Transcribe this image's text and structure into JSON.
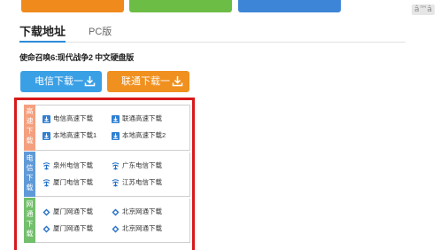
{
  "corner_label": "â™â",
  "tabs": [
    {
      "label": "下载地址"
    },
    {
      "label": "PC版"
    }
  ],
  "game_title": "使命召唤6:现代战争2 中文硬盘版",
  "buttons": {
    "telecom": "电信下载一",
    "unicom": "联通下载一"
  },
  "groups": [
    {
      "label": "高速下载",
      "items": [
        "电信高速下载",
        "联通高速下载",
        "本地高速下载1",
        "本地高速下载2"
      ],
      "icon": "download-icon"
    },
    {
      "label": "电信下载",
      "items": [
        "泉州电信下载",
        "广东电信下载",
        "厦门电信下载",
        "江苏电信下载"
      ],
      "icon": "telecom-logo-icon"
    },
    {
      "label": "网通下载",
      "items": [
        "厦门网通下载",
        "北京网通下载",
        "厦门网通下载",
        "北京网通下载"
      ],
      "icon": "netcom-logo-icon"
    }
  ],
  "colors": {
    "top_orange": "#f08a1c",
    "top_green": "#6cbd45",
    "top_blue": "#3d85d6",
    "highlight_frame": "#d7191c"
  }
}
